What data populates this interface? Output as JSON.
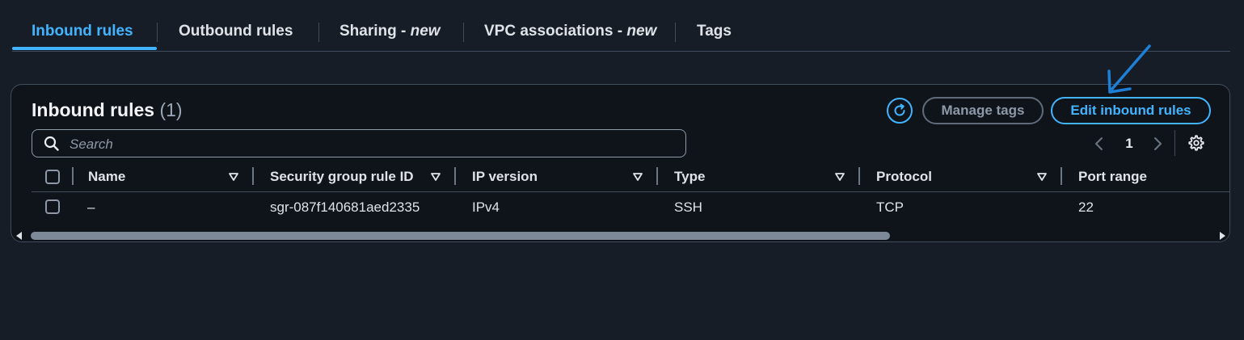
{
  "tabs": [
    {
      "label": "Inbound rules"
    },
    {
      "label": "Outbound rules"
    },
    {
      "label": "Sharing - ",
      "tag": "new"
    },
    {
      "label": "VPC associations - ",
      "tag": "new"
    },
    {
      "label": "Tags"
    }
  ],
  "panel": {
    "title": "Inbound rules",
    "count": "(1)",
    "manage_tags_label": "Manage tags",
    "edit_inbound_label": "Edit inbound rules",
    "refresh_icon": "refresh-icon",
    "search_placeholder": "Search",
    "current_page": "1"
  },
  "table": {
    "columns": [
      "Name",
      "Security group rule ID",
      "IP version",
      "Type",
      "Protocol",
      "Port range"
    ],
    "rows": [
      {
        "name": "–",
        "rule_id": "sgr-087f140681aed2335",
        "ip_version": "IPv4",
        "type": "SSH",
        "protocol": "TCP",
        "port_range": "22"
      }
    ]
  },
  "colors": {
    "background": "#161d26",
    "panel": "#0f141a",
    "accent": "#42b4ff",
    "annotation_arrow": "#1e7fd6",
    "border": "#414d5c"
  }
}
